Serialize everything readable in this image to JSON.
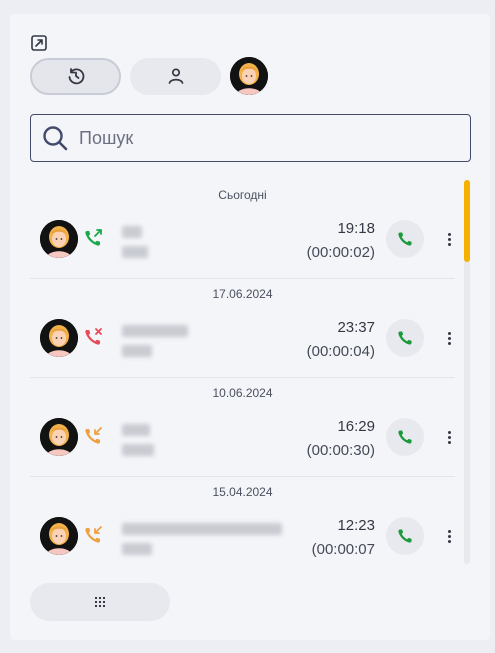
{
  "toolbar": {
    "expand_icon": "expand-icon",
    "tabs": [
      {
        "icon": "history-icon",
        "active": true
      },
      {
        "icon": "contacts-icon",
        "active": false
      }
    ],
    "avatar": "user-avatar"
  },
  "search": {
    "placeholder": "Пошук",
    "value": ""
  },
  "colors": {
    "outgoing": "#1aa84a",
    "missed": "#e84a5a",
    "incoming": "#f0a040",
    "call_button": "#1a9a3a",
    "scroll_thumb": "#f5b000"
  },
  "calls": [
    {
      "date": "Сьогодні",
      "direction": "outgoing",
      "time": "19:18",
      "duration": "(00:00:02)"
    },
    {
      "date": "17.06.2024",
      "direction": "missed",
      "time": "23:37",
      "duration": "(00:00:04)"
    },
    {
      "date": "10.06.2024",
      "direction": "incoming",
      "time": "16:29",
      "duration": "(00:00:30)"
    },
    {
      "date": "15.04.2024",
      "direction": "incoming",
      "time": "12:23",
      "duration": "(00:00:07"
    }
  ],
  "footer": {
    "keypad_icon": "dialpad-icon"
  }
}
